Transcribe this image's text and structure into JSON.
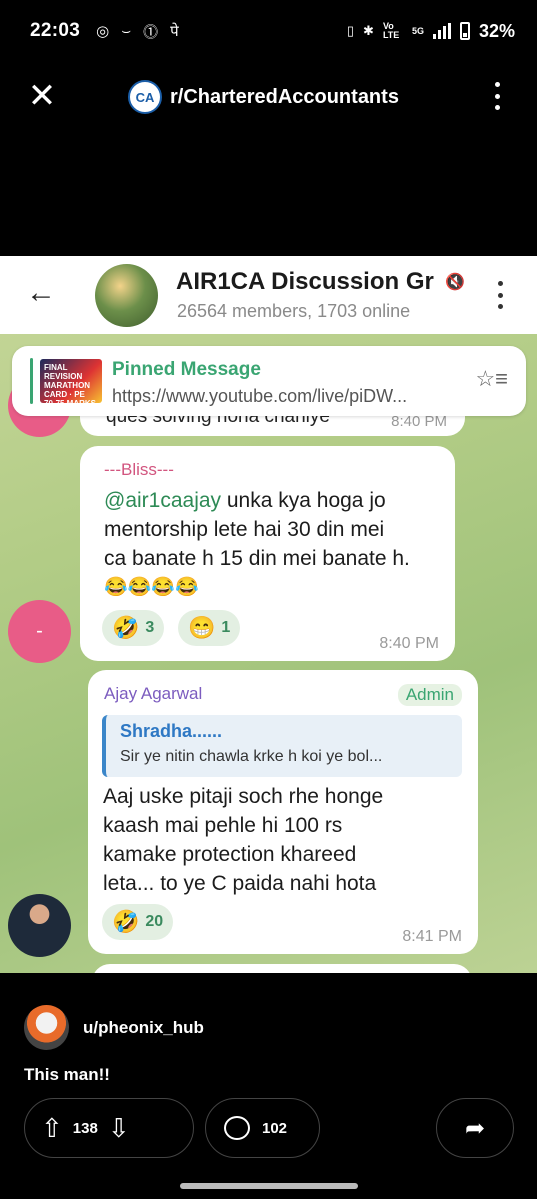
{
  "status_bar": {
    "time": "22:03",
    "left_icons": [
      "instagram-icon",
      "smile-icon",
      "alert-icon",
      "pe-icon"
    ],
    "battery": "32%",
    "network": "5G",
    "volte": "Vo LTE"
  },
  "reddit_header": {
    "close_icon": "close-icon",
    "subreddit": "r/CharteredAccountants",
    "logo_text": "CA"
  },
  "telegram": {
    "group_name": "AIR1CA Discussion Gr",
    "members": "26564 members, 1703 online",
    "pinned": {
      "title": "Pinned Message",
      "link": "https://www.youtube.com/live/piDW...",
      "thumb_text": "FINAL REVISION MARATHON CARD · PE 70-75 MARKS"
    },
    "previous_message": {
      "text": "ques solving hona chahiye",
      "time": "8:40 PM"
    },
    "message1": {
      "sender": "---Bliss---",
      "mention": "@air1caajay",
      "text_lines": [
        " unka kya hoga jo",
        "mentorship lete hai 30 din mei",
        "ca banate h 15 din mei banate h.",
        "😂😂😂😂"
      ],
      "reactions": [
        {
          "emoji": "🤣",
          "count": "3"
        },
        {
          "emoji": "😁",
          "count": "1"
        }
      ],
      "time": "8:40 PM",
      "avatar_initial": "-"
    },
    "message2": {
      "sender": "Ajay Agarwal",
      "role": "Admin",
      "reply_to": {
        "name": "Shradha......",
        "text": "Sir ye nitin chawla krke h koi ye bol..."
      },
      "text_lines": [
        "Aaj uske pitaji soch rhe honge",
        "kaash mai pehle hi 100 rs",
        "kamake protection khareed",
        "leta... to ye C paida nahi hota"
      ],
      "reactions": [
        {
          "emoji": "🤣",
          "count": "20"
        }
      ],
      "time": "8:41 PM"
    }
  },
  "post": {
    "author": "u/pheonix_hub",
    "title": "This man!!",
    "upvotes": "138",
    "comments": "102",
    "colors": {
      "accent_green": "#3aa572",
      "mention_green": "#2d8a55",
      "bliss_pink": "#d2557f",
      "ajay_purple": "#7c5cbf",
      "reply_blue": "#2e78c4"
    }
  }
}
